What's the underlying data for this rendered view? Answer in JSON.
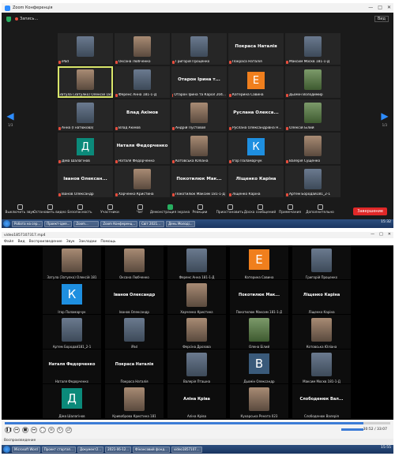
{
  "zoom": {
    "window_title": "Zoom Конференція",
    "recording_label": "Запись...",
    "view_label": "Вид",
    "page_left": "1/3",
    "page_right": "1/3",
    "tiles": [
      {
        "kind": "photo",
        "tone": "cool",
        "label": "iPad"
      },
      {
        "kind": "photo",
        "tone": "warm",
        "label": "Оксана Любченко"
      },
      {
        "kind": "photo",
        "tone": "cool",
        "label": "Григорій Проценко"
      },
      {
        "kind": "name",
        "bigname": "Покраса Наталія",
        "label": "Покраса Наталія"
      },
      {
        "kind": "photo",
        "tone": "cool",
        "label": "Максим Москв 181-1-Д"
      },
      {
        "kind": "photo",
        "tone": "warm",
        "label": "Затула (Затулко) Олексій 181",
        "active": true
      },
      {
        "kind": "photo",
        "tone": "cool",
        "label": "Ференс Анна 181-1-Д"
      },
      {
        "kind": "name",
        "bigname": "Отарон Ірина т...",
        "label": "Отарон Ірина та Карол 204..."
      },
      {
        "kind": "avatar",
        "letter": "Е",
        "color": "#f07f1d",
        "label": "Катерина Савина"
      },
      {
        "kind": "photo",
        "tone": "green",
        "label": "Дьомін Володимир"
      },
      {
        "kind": "photo",
        "tone": "cool",
        "label": "Анна (Гнатюкова)"
      },
      {
        "kind": "name",
        "bigname": "Влад Акімов",
        "label": "Влад Акімов"
      },
      {
        "kind": "photo",
        "tone": "warm",
        "label": "Андрій Пустовой"
      },
      {
        "kind": "name",
        "bigname": "Руслана Олекса...",
        "label": "Руслана Олександрівна Н..."
      },
      {
        "kind": "photo",
        "tone": "green",
        "label": "Олексій Білий"
      },
      {
        "kind": "avatar",
        "letter": "Д",
        "color": "#0b8a7a",
        "label": "Діма Шалагінов"
      },
      {
        "kind": "name",
        "bigname": "Наталя Федорченко",
        "label": "Наталя Федорченко"
      },
      {
        "kind": "photo",
        "tone": "warm",
        "label": "Котовська Юліана"
      },
      {
        "kind": "avatar",
        "letter": "К",
        "color": "#1e8fe0",
        "label": "Ігор Паламарчук"
      },
      {
        "kind": "photo",
        "tone": "warm",
        "label": "Валерія Сущенко"
      },
      {
        "kind": "name",
        "bigname": "Іванов Олексан...",
        "label": "Іванов Олександр"
      },
      {
        "kind": "photo",
        "tone": "warm",
        "label": "Харченко Кристина"
      },
      {
        "kind": "name",
        "bigname": "Покотилюк Мак...",
        "label": "Покотилюк Максим 181-1-Д"
      },
      {
        "kind": "name",
        "bigname": "Ліщенко Каріна",
        "label": "Ліщенко Каріна"
      },
      {
        "kind": "photo",
        "tone": "cool",
        "label": "Артем Бородай181_2-1"
      }
    ],
    "toolbar": [
      {
        "label": "Выключить звук",
        "name": "mute"
      },
      {
        "label": "Остановить видео",
        "name": "stop-video"
      },
      {
        "label": "Безопасность",
        "name": "security"
      },
      {
        "label": "Участники",
        "name": "participants"
      },
      {
        "label": "Чат",
        "name": "chat"
      },
      {
        "label": "Демонстрация экрана",
        "name": "share-screen"
      },
      {
        "label": "Реакции",
        "name": "reactions"
      },
      {
        "label": "Приостановить",
        "name": "pause"
      },
      {
        "label": "Доска сообщений",
        "name": "whiteboard"
      },
      {
        "label": "Примечания",
        "name": "notes"
      },
      {
        "label": "Дополнительно",
        "name": "more"
      }
    ],
    "end_label": "Завершение",
    "taskbar": [
      "Робота на сер...",
      "Проект-ідея...",
      "Zoom...",
      "Zoom Конференц...",
      "Світ 2021...",
      "День Молоді..."
    ],
    "clock": "15:32"
  },
  "video": {
    "window_title": "video1857107317.mp4",
    "menu": [
      "Файл",
      "Вид",
      "Воспроизведение",
      "Звук",
      "Закладки",
      "Помощь"
    ],
    "tiles": [
      {
        "kind": "photo",
        "tone": "warm",
        "label": "Затула (Затулко) Олексій 181"
      },
      {
        "kind": "photo",
        "tone": "warm",
        "label": "Оксана Любченко"
      },
      {
        "kind": "photo",
        "tone": "cool",
        "label": "Ференс Анна 181-1-Д"
      },
      {
        "kind": "avatar",
        "letter": "Е",
        "color": "#f07f1d",
        "label": "Катерина Савина"
      },
      {
        "kind": "photo",
        "tone": "cool",
        "label": "Григорій Проценко"
      },
      {
        "kind": "avatar",
        "letter": "К",
        "color": "#1e8fe0",
        "label": "Ігор Паламарчук"
      },
      {
        "kind": "name",
        "bigname": "Іванов Олександр",
        "label": "Іванов Олександр"
      },
      {
        "kind": "photo",
        "tone": "warm",
        "label": "Харченко Кристина"
      },
      {
        "kind": "name",
        "bigname": "Покотилюк Мак...",
        "label": "Покотилюк Максим 181-1-Д"
      },
      {
        "kind": "name",
        "bigname": "Ліщенко Каріна",
        "label": "Ліщенко Каріна"
      },
      {
        "kind": "photo",
        "tone": "cool",
        "label": "Артем Бородай181_2-1"
      },
      {
        "kind": "photo",
        "tone": "cool",
        "label": "iPad"
      },
      {
        "kind": "photo",
        "tone": "warm",
        "label": "Ферсіна Дрозова"
      },
      {
        "kind": "photo",
        "tone": "green",
        "label": "Олена Білий"
      },
      {
        "kind": "photo",
        "tone": "warm",
        "label": "Котовська Юліана"
      },
      {
        "kind": "name",
        "bigname": "Наталя Федорченко",
        "label": "Наталя Федорченко"
      },
      {
        "kind": "name",
        "bigname": "Покраса Наталія",
        "label": "Покраса Наталія"
      },
      {
        "kind": "photo",
        "tone": "cool",
        "label": "Валерія Пташна"
      },
      {
        "kind": "avatar",
        "letter": "В",
        "color": "#3a5a7a",
        "label": "Дьомін Олександр"
      },
      {
        "kind": "photo",
        "tone": "cool",
        "label": "Максим Москв 181-1-Д"
      },
      {
        "kind": "avatar",
        "letter": "Д",
        "color": "#0b8a7a",
        "label": "Діма Шалагінов"
      },
      {
        "kind": "photo",
        "tone": "warm",
        "label": "Кривоброва Кристина 181"
      },
      {
        "kind": "name",
        "bigname": "Аліна Кріва",
        "label": "Аліна Кріва"
      },
      {
        "kind": "photo",
        "tone": "warm",
        "label": "Кухарська Рената 023"
      },
      {
        "kind": "name",
        "bigname": "Слободенюк Вал...",
        "label": "Слободенюк Валерія"
      }
    ],
    "time": "30:52 / 33:07",
    "progress_fraction": 0.93,
    "volume_fraction": 1.0,
    "status": "Воспроизведение",
    "taskbar": [
      "Microsoft Word",
      "Проект стартап...",
      "Документ2...",
      "2021-06-12...",
      "Фінансовий фонд...",
      "video1857107..."
    ],
    "clock": "15:55"
  }
}
